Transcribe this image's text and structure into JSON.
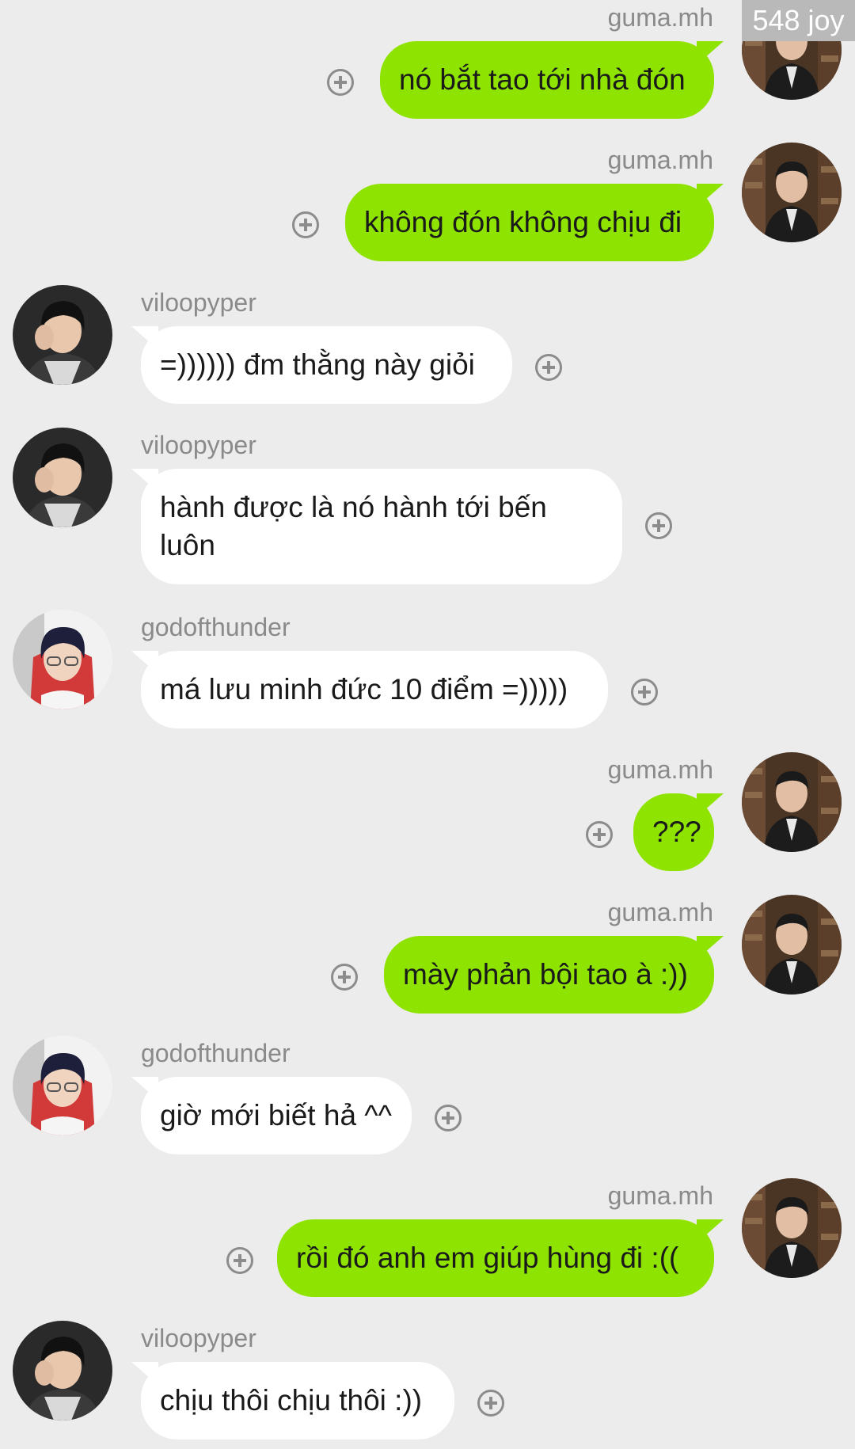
{
  "badge": "548 joy",
  "colors": {
    "background": "#ececec",
    "outgoing_bubble": "#8fe300",
    "incoming_bubble": "#ffffff",
    "sender_name": "#8a8a8a",
    "add_icon": "#8c8c8c"
  },
  "messages": [
    {
      "sender": "guma.mh",
      "direction": "outgoing",
      "avatar": "guma-avatar",
      "text": "nó bắt tao tới nhà đón"
    },
    {
      "sender": "guma.mh",
      "direction": "outgoing",
      "avatar": "guma-avatar",
      "text": "không đón không chịu đi"
    },
    {
      "sender": "viloopyper",
      "direction": "incoming",
      "avatar": "viloopyper-avatar",
      "text": "=)))))) đm thằng này giỏi"
    },
    {
      "sender": "viloopyper",
      "direction": "incoming",
      "avatar": "viloopyper-avatar",
      "text": "hành được là nó hành tới bến luôn"
    },
    {
      "sender": "godofthunder",
      "direction": "incoming",
      "avatar": "godofthunder-avatar",
      "text": "má lưu minh đức 10 điểm =)))))"
    },
    {
      "sender": "guma.mh",
      "direction": "outgoing",
      "avatar": "guma-avatar",
      "text": "???"
    },
    {
      "sender": "guma.mh",
      "direction": "outgoing",
      "avatar": "guma-avatar",
      "text": "mày phản bội tao à :))"
    },
    {
      "sender": "godofthunder",
      "direction": "incoming",
      "avatar": "godofthunder-avatar",
      "text": "giờ mới biết hả ^^"
    },
    {
      "sender": "guma.mh",
      "direction": "outgoing",
      "avatar": "guma-avatar",
      "text": "rồi đó anh em giúp hùng đi :(("
    },
    {
      "sender": "viloopyper",
      "direction": "incoming",
      "avatar": "viloopyper-avatar",
      "text": "chịu thôi chịu thôi :))"
    }
  ]
}
